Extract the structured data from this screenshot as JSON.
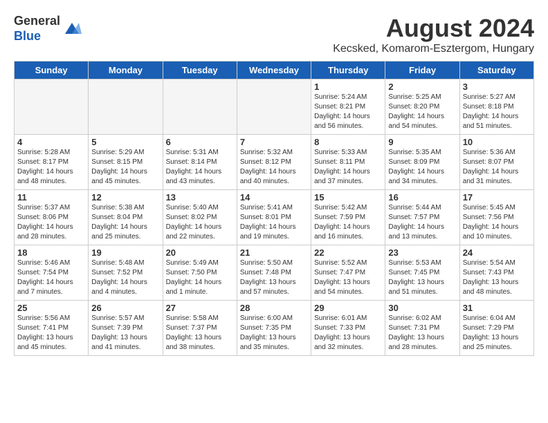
{
  "header": {
    "logo_general": "General",
    "logo_blue": "Blue",
    "main_title": "August 2024",
    "subtitle": "Kecsked, Komarom-Esztergom, Hungary"
  },
  "weekdays": [
    "Sunday",
    "Monday",
    "Tuesday",
    "Wednesday",
    "Thursday",
    "Friday",
    "Saturday"
  ],
  "weeks": [
    [
      {
        "day": "",
        "empty": true
      },
      {
        "day": "",
        "empty": true
      },
      {
        "day": "",
        "empty": true
      },
      {
        "day": "",
        "empty": true
      },
      {
        "day": "1",
        "sunrise": "5:24 AM",
        "sunset": "8:21 PM",
        "daylight": "14 hours and 56 minutes."
      },
      {
        "day": "2",
        "sunrise": "5:25 AM",
        "sunset": "8:20 PM",
        "daylight": "14 hours and 54 minutes."
      },
      {
        "day": "3",
        "sunrise": "5:27 AM",
        "sunset": "8:18 PM",
        "daylight": "14 hours and 51 minutes."
      }
    ],
    [
      {
        "day": "4",
        "sunrise": "5:28 AM",
        "sunset": "8:17 PM",
        "daylight": "14 hours and 48 minutes."
      },
      {
        "day": "5",
        "sunrise": "5:29 AM",
        "sunset": "8:15 PM",
        "daylight": "14 hours and 45 minutes."
      },
      {
        "day": "6",
        "sunrise": "5:31 AM",
        "sunset": "8:14 PM",
        "daylight": "14 hours and 43 minutes."
      },
      {
        "day": "7",
        "sunrise": "5:32 AM",
        "sunset": "8:12 PM",
        "daylight": "14 hours and 40 minutes."
      },
      {
        "day": "8",
        "sunrise": "5:33 AM",
        "sunset": "8:11 PM",
        "daylight": "14 hours and 37 minutes."
      },
      {
        "day": "9",
        "sunrise": "5:35 AM",
        "sunset": "8:09 PM",
        "daylight": "14 hours and 34 minutes."
      },
      {
        "day": "10",
        "sunrise": "5:36 AM",
        "sunset": "8:07 PM",
        "daylight": "14 hours and 31 minutes."
      }
    ],
    [
      {
        "day": "11",
        "sunrise": "5:37 AM",
        "sunset": "8:06 PM",
        "daylight": "14 hours and 28 minutes."
      },
      {
        "day": "12",
        "sunrise": "5:38 AM",
        "sunset": "8:04 PM",
        "daylight": "14 hours and 25 minutes."
      },
      {
        "day": "13",
        "sunrise": "5:40 AM",
        "sunset": "8:02 PM",
        "daylight": "14 hours and 22 minutes."
      },
      {
        "day": "14",
        "sunrise": "5:41 AM",
        "sunset": "8:01 PM",
        "daylight": "14 hours and 19 minutes."
      },
      {
        "day": "15",
        "sunrise": "5:42 AM",
        "sunset": "7:59 PM",
        "daylight": "14 hours and 16 minutes."
      },
      {
        "day": "16",
        "sunrise": "5:44 AM",
        "sunset": "7:57 PM",
        "daylight": "14 hours and 13 minutes."
      },
      {
        "day": "17",
        "sunrise": "5:45 AM",
        "sunset": "7:56 PM",
        "daylight": "14 hours and 10 minutes."
      }
    ],
    [
      {
        "day": "18",
        "sunrise": "5:46 AM",
        "sunset": "7:54 PM",
        "daylight": "14 hours and 7 minutes."
      },
      {
        "day": "19",
        "sunrise": "5:48 AM",
        "sunset": "7:52 PM",
        "daylight": "14 hours and 4 minutes."
      },
      {
        "day": "20",
        "sunrise": "5:49 AM",
        "sunset": "7:50 PM",
        "daylight": "14 hours and 1 minute."
      },
      {
        "day": "21",
        "sunrise": "5:50 AM",
        "sunset": "7:48 PM",
        "daylight": "13 hours and 57 minutes."
      },
      {
        "day": "22",
        "sunrise": "5:52 AM",
        "sunset": "7:47 PM",
        "daylight": "13 hours and 54 minutes."
      },
      {
        "day": "23",
        "sunrise": "5:53 AM",
        "sunset": "7:45 PM",
        "daylight": "13 hours and 51 minutes."
      },
      {
        "day": "24",
        "sunrise": "5:54 AM",
        "sunset": "7:43 PM",
        "daylight": "13 hours and 48 minutes."
      }
    ],
    [
      {
        "day": "25",
        "sunrise": "5:56 AM",
        "sunset": "7:41 PM",
        "daylight": "13 hours and 45 minutes."
      },
      {
        "day": "26",
        "sunrise": "5:57 AM",
        "sunset": "7:39 PM",
        "daylight": "13 hours and 41 minutes."
      },
      {
        "day": "27",
        "sunrise": "5:58 AM",
        "sunset": "7:37 PM",
        "daylight": "13 hours and 38 minutes."
      },
      {
        "day": "28",
        "sunrise": "6:00 AM",
        "sunset": "7:35 PM",
        "daylight": "13 hours and 35 minutes."
      },
      {
        "day": "29",
        "sunrise": "6:01 AM",
        "sunset": "7:33 PM",
        "daylight": "13 hours and 32 minutes."
      },
      {
        "day": "30",
        "sunrise": "6:02 AM",
        "sunset": "7:31 PM",
        "daylight": "13 hours and 28 minutes."
      },
      {
        "day": "31",
        "sunrise": "6:04 AM",
        "sunset": "7:29 PM",
        "daylight": "13 hours and 25 minutes."
      }
    ]
  ]
}
